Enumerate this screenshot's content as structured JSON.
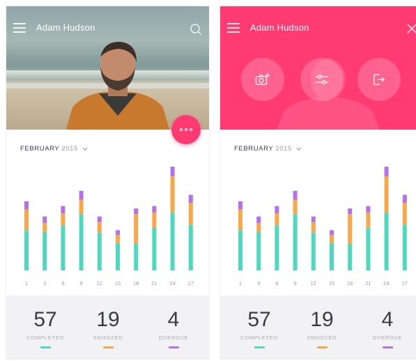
{
  "screens": [
    {
      "user_name": "Adam Hudson",
      "month": "FEBRUARY",
      "year": "2015",
      "stats": [
        {
          "value": "57",
          "label": "COMPLETED"
        },
        {
          "value": "19",
          "label": "SNOOZED"
        },
        {
          "value": "4",
          "label": "OVERDUE"
        }
      ]
    },
    {
      "user_name": "Adam Hudson",
      "month": "FEBRUARY",
      "year": "2015",
      "stats": [
        {
          "value": "57",
          "label": "COMPLETED"
        },
        {
          "value": "19",
          "label": "SNOOZED"
        },
        {
          "value": "4",
          "label": "OVERDUE"
        }
      ]
    }
  ],
  "icons": {
    "left_screen": [
      "menu-icon",
      "search-icon",
      "more-icon"
    ],
    "right_screen": [
      "menu-icon",
      "close-icon",
      "add-photo-icon",
      "sliders-icon",
      "logout-icon"
    ]
  },
  "colors": {
    "accent": "#ff3b72",
    "completed": "#4fd8be",
    "snoozed": "#f9a74a",
    "overdue": "#b471e9"
  },
  "chart_data": {
    "type": "bar",
    "stacked": true,
    "categories": [
      "1",
      "3",
      "6",
      "9",
      "12",
      "15",
      "18",
      "21",
      "24",
      "27"
    ],
    "series": [
      {
        "key": "completed",
        "values": [
          50,
          48,
          56,
          70,
          47,
          34,
          33,
          53,
          72,
          57
        ]
      },
      {
        "key": "snoozed",
        "values": [
          26,
          11,
          15,
          18,
          13,
          10,
          37,
          19,
          45,
          27
        ]
      },
      {
        "key": "overdue",
        "values": [
          10,
          8,
          9,
          11,
          7,
          6,
          7,
          8,
          12,
          10
        ]
      }
    ],
    "ylim": [
      0,
      130
    ]
  }
}
